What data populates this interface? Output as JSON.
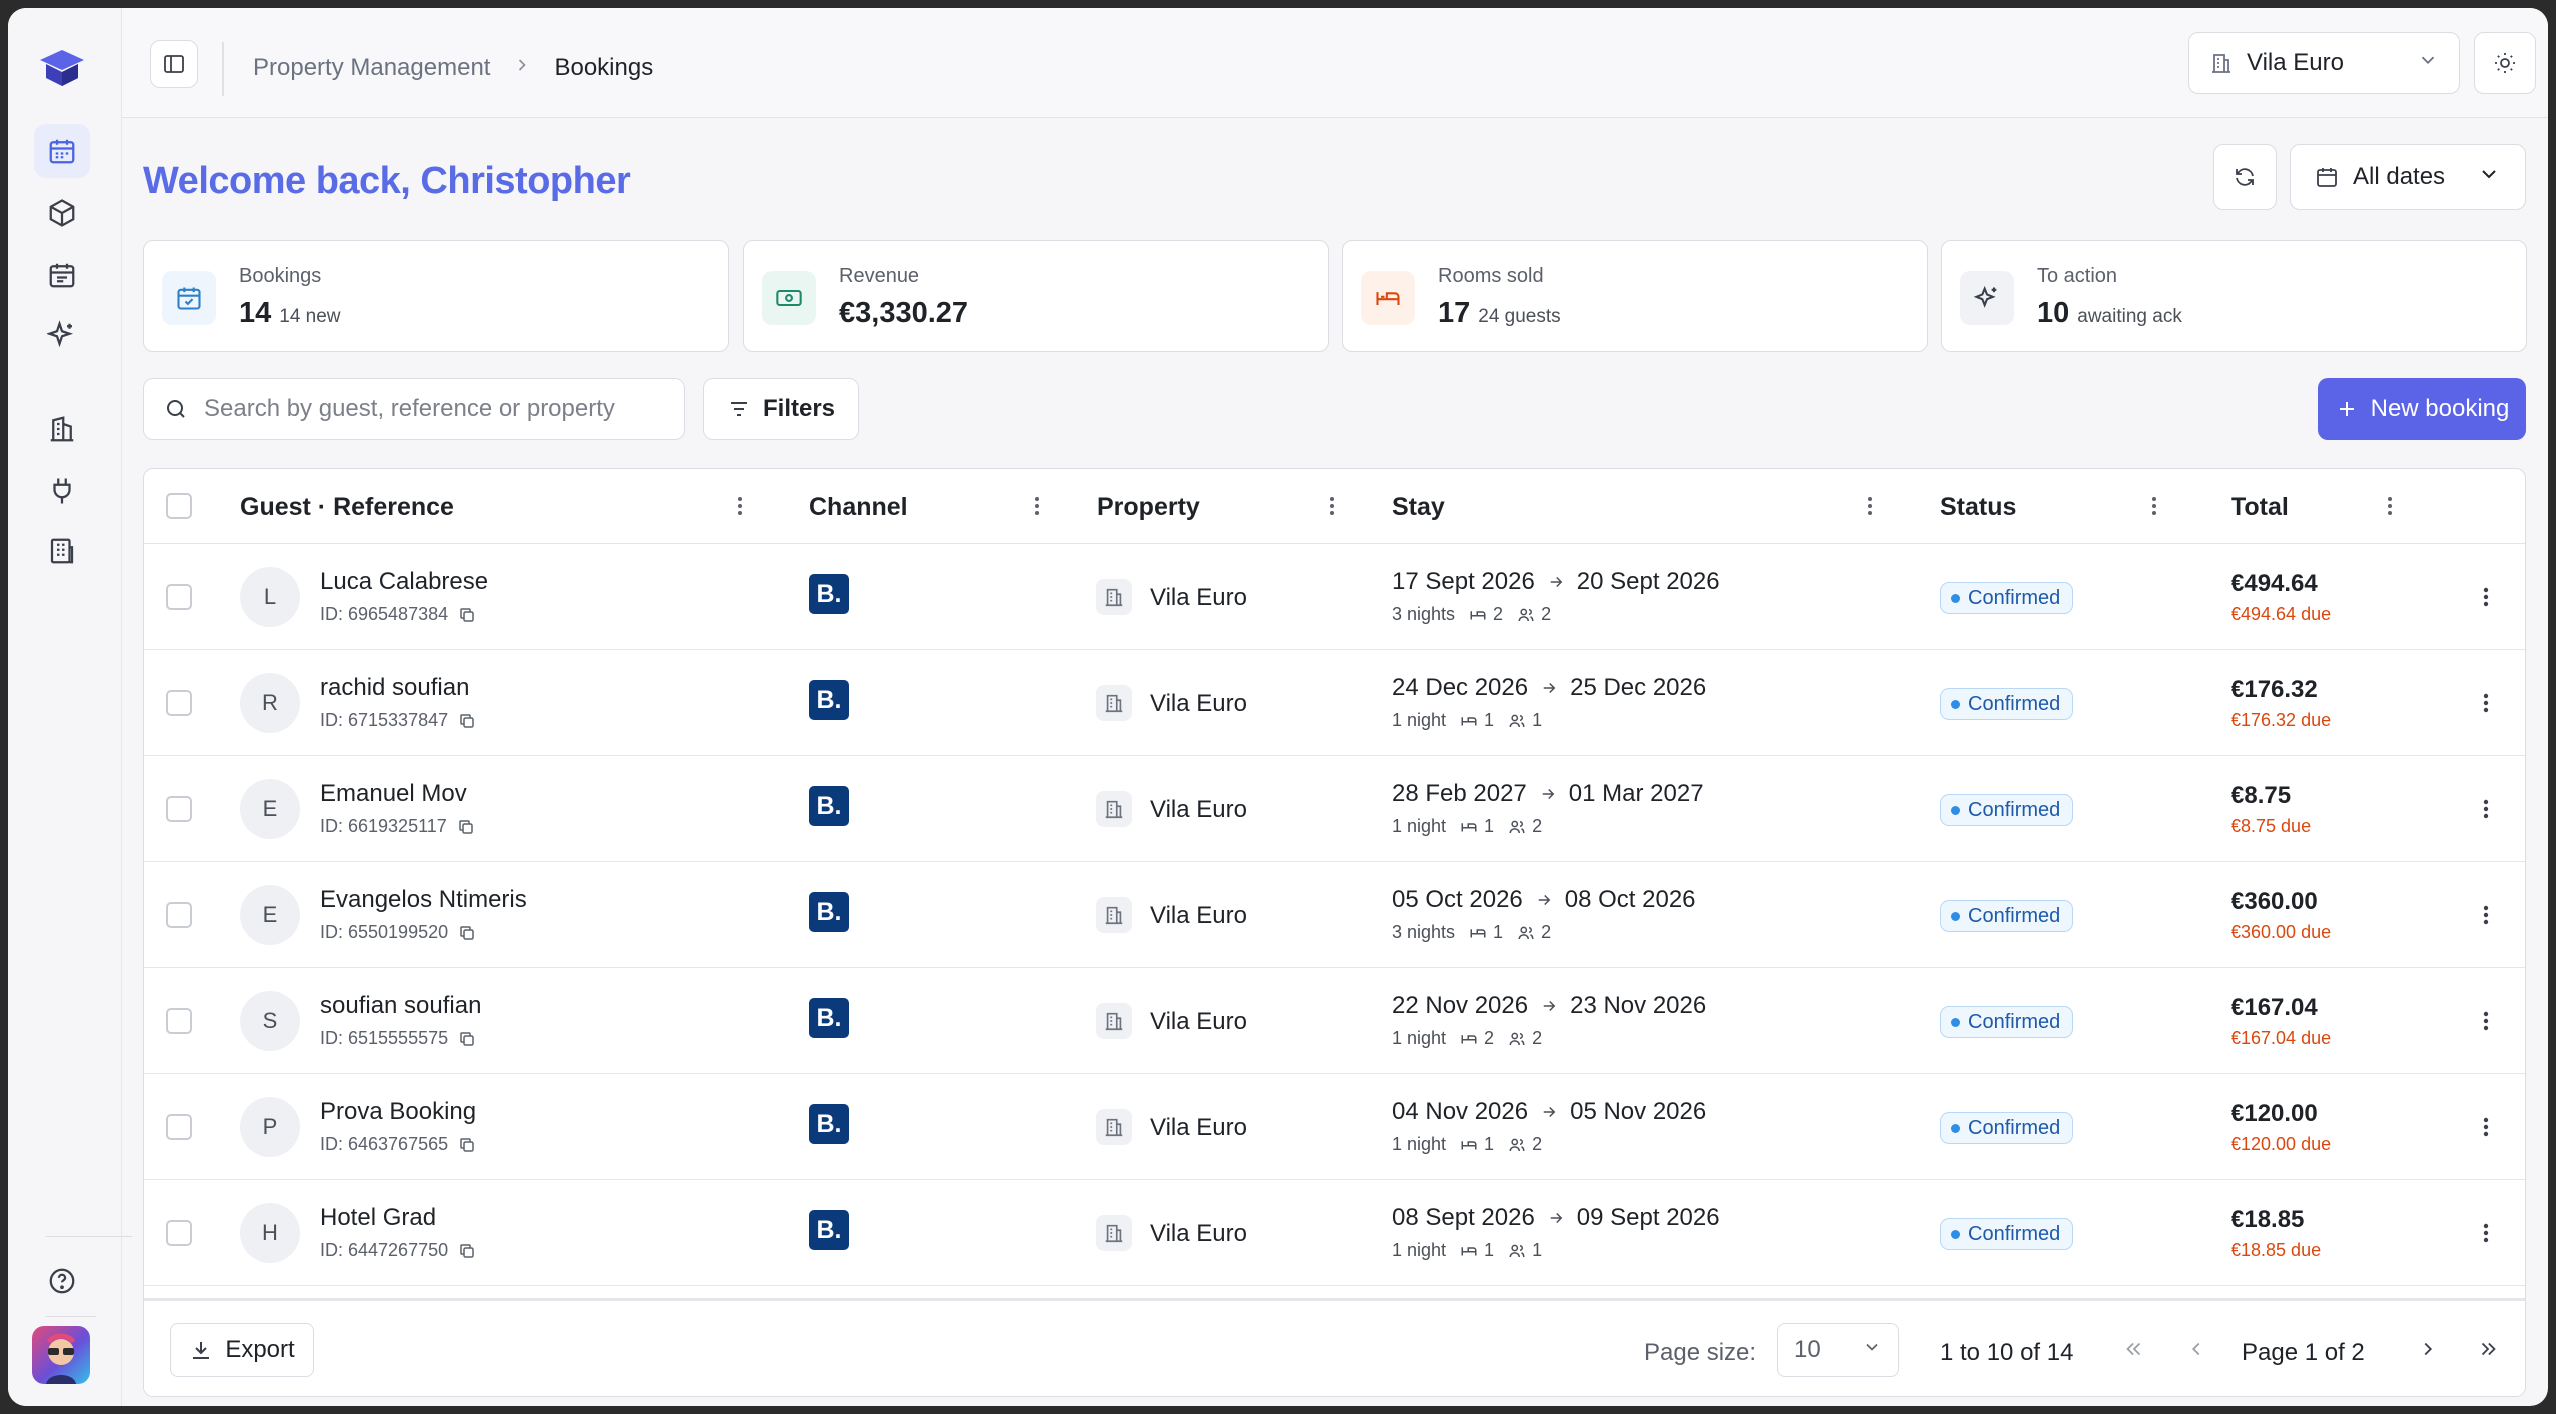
{
  "topbar": {
    "breadcrumb_parent": "Property Management",
    "breadcrumb_current": "Bookings",
    "property_select": "Vila Euro"
  },
  "header": {
    "welcome": "Welcome back, Christopher",
    "date_filter": "All dates"
  },
  "stats": [
    {
      "label": "Bookings",
      "value": "14",
      "sub": "14 new",
      "icon": "calendar-check-icon",
      "color": "#2e7fc9"
    },
    {
      "label": "Revenue",
      "value": "€3,330.27",
      "sub": "",
      "icon": "banknote-icon",
      "color": "#1e8a6a"
    },
    {
      "label": "Rooms sold",
      "value": "17",
      "sub": "24 guests",
      "icon": "bed-icon",
      "color": "#d9480f"
    },
    {
      "label": "To action",
      "value": "10",
      "sub": "awaiting ack",
      "icon": "sparkles-icon",
      "color": "#3a3f4a"
    }
  ],
  "toolbar": {
    "search_placeholder": "Search by guest, reference or property",
    "filters_label": "Filters",
    "new_booking_label": "New booking"
  },
  "table": {
    "columns": [
      "Guest · Reference",
      "Channel",
      "Property",
      "Stay",
      "Status",
      "Total"
    ],
    "rows": [
      {
        "initial": "L",
        "name": "Luca Calabrese",
        "ref": "ID: 6965487384",
        "channel": "B.",
        "property": "Vila Euro",
        "check_in": "17 Sept 2026",
        "check_out": "20 Sept 2026",
        "nights": "3 nights",
        "rooms": "2",
        "guests": "2",
        "status": "Confirmed",
        "total": "€494.64",
        "due": "€494.64 due"
      },
      {
        "initial": "R",
        "name": "rachid soufian",
        "ref": "ID: 6715337847",
        "channel": "B.",
        "property": "Vila Euro",
        "check_in": "24 Dec 2026",
        "check_out": "25 Dec 2026",
        "nights": "1 night",
        "rooms": "1",
        "guests": "1",
        "status": "Confirmed",
        "total": "€176.32",
        "due": "€176.32 due"
      },
      {
        "initial": "E",
        "name": "Emanuel Mov",
        "ref": "ID: 6619325117",
        "channel": "B.",
        "property": "Vila Euro",
        "check_in": "28 Feb 2027",
        "check_out": "01 Mar 2027",
        "nights": "1 night",
        "rooms": "1",
        "guests": "2",
        "status": "Confirmed",
        "total": "€8.75",
        "due": "€8.75 due"
      },
      {
        "initial": "E",
        "name": "Evangelos Ntimeris",
        "ref": "ID: 6550199520",
        "channel": "B.",
        "property": "Vila Euro",
        "check_in": "05 Oct 2026",
        "check_out": "08 Oct 2026",
        "nights": "3 nights",
        "rooms": "1",
        "guests": "2",
        "status": "Confirmed",
        "total": "€360.00",
        "due": "€360.00 due"
      },
      {
        "initial": "S",
        "name": "soufian soufian",
        "ref": "ID: 6515555575",
        "channel": "B.",
        "property": "Vila Euro",
        "check_in": "22 Nov 2026",
        "check_out": "23 Nov 2026",
        "nights": "1 night",
        "rooms": "2",
        "guests": "2",
        "status": "Confirmed",
        "total": "€167.04",
        "due": "€167.04 due"
      },
      {
        "initial": "P",
        "name": "Prova Booking",
        "ref": "ID: 6463767565",
        "channel": "B.",
        "property": "Vila Euro",
        "check_in": "04 Nov 2026",
        "check_out": "05 Nov 2026",
        "nights": "1 night",
        "rooms": "1",
        "guests": "2",
        "status": "Confirmed",
        "total": "€120.00",
        "due": "€120.00 due"
      },
      {
        "initial": "H",
        "name": "Hotel Grad",
        "ref": "ID: 6447267750",
        "channel": "B.",
        "property": "Vila Euro",
        "check_in": "08 Sept 2026",
        "check_out": "09 Sept 2026",
        "nights": "1 night",
        "rooms": "1",
        "guests": "1",
        "status": "Confirmed",
        "total": "€18.85",
        "due": "€18.85 due"
      }
    ]
  },
  "footer": {
    "export_label": "Export",
    "page_size_label": "Page size:",
    "page_size_value": "10",
    "range": "1 to 10 of 14",
    "page_info": "Page 1 of 2"
  },
  "colors": {
    "accent": "#5b63e6",
    "status_blue": "#2e8de8",
    "due_orange": "#d9480f",
    "booking_com": "#0b3a7a"
  }
}
